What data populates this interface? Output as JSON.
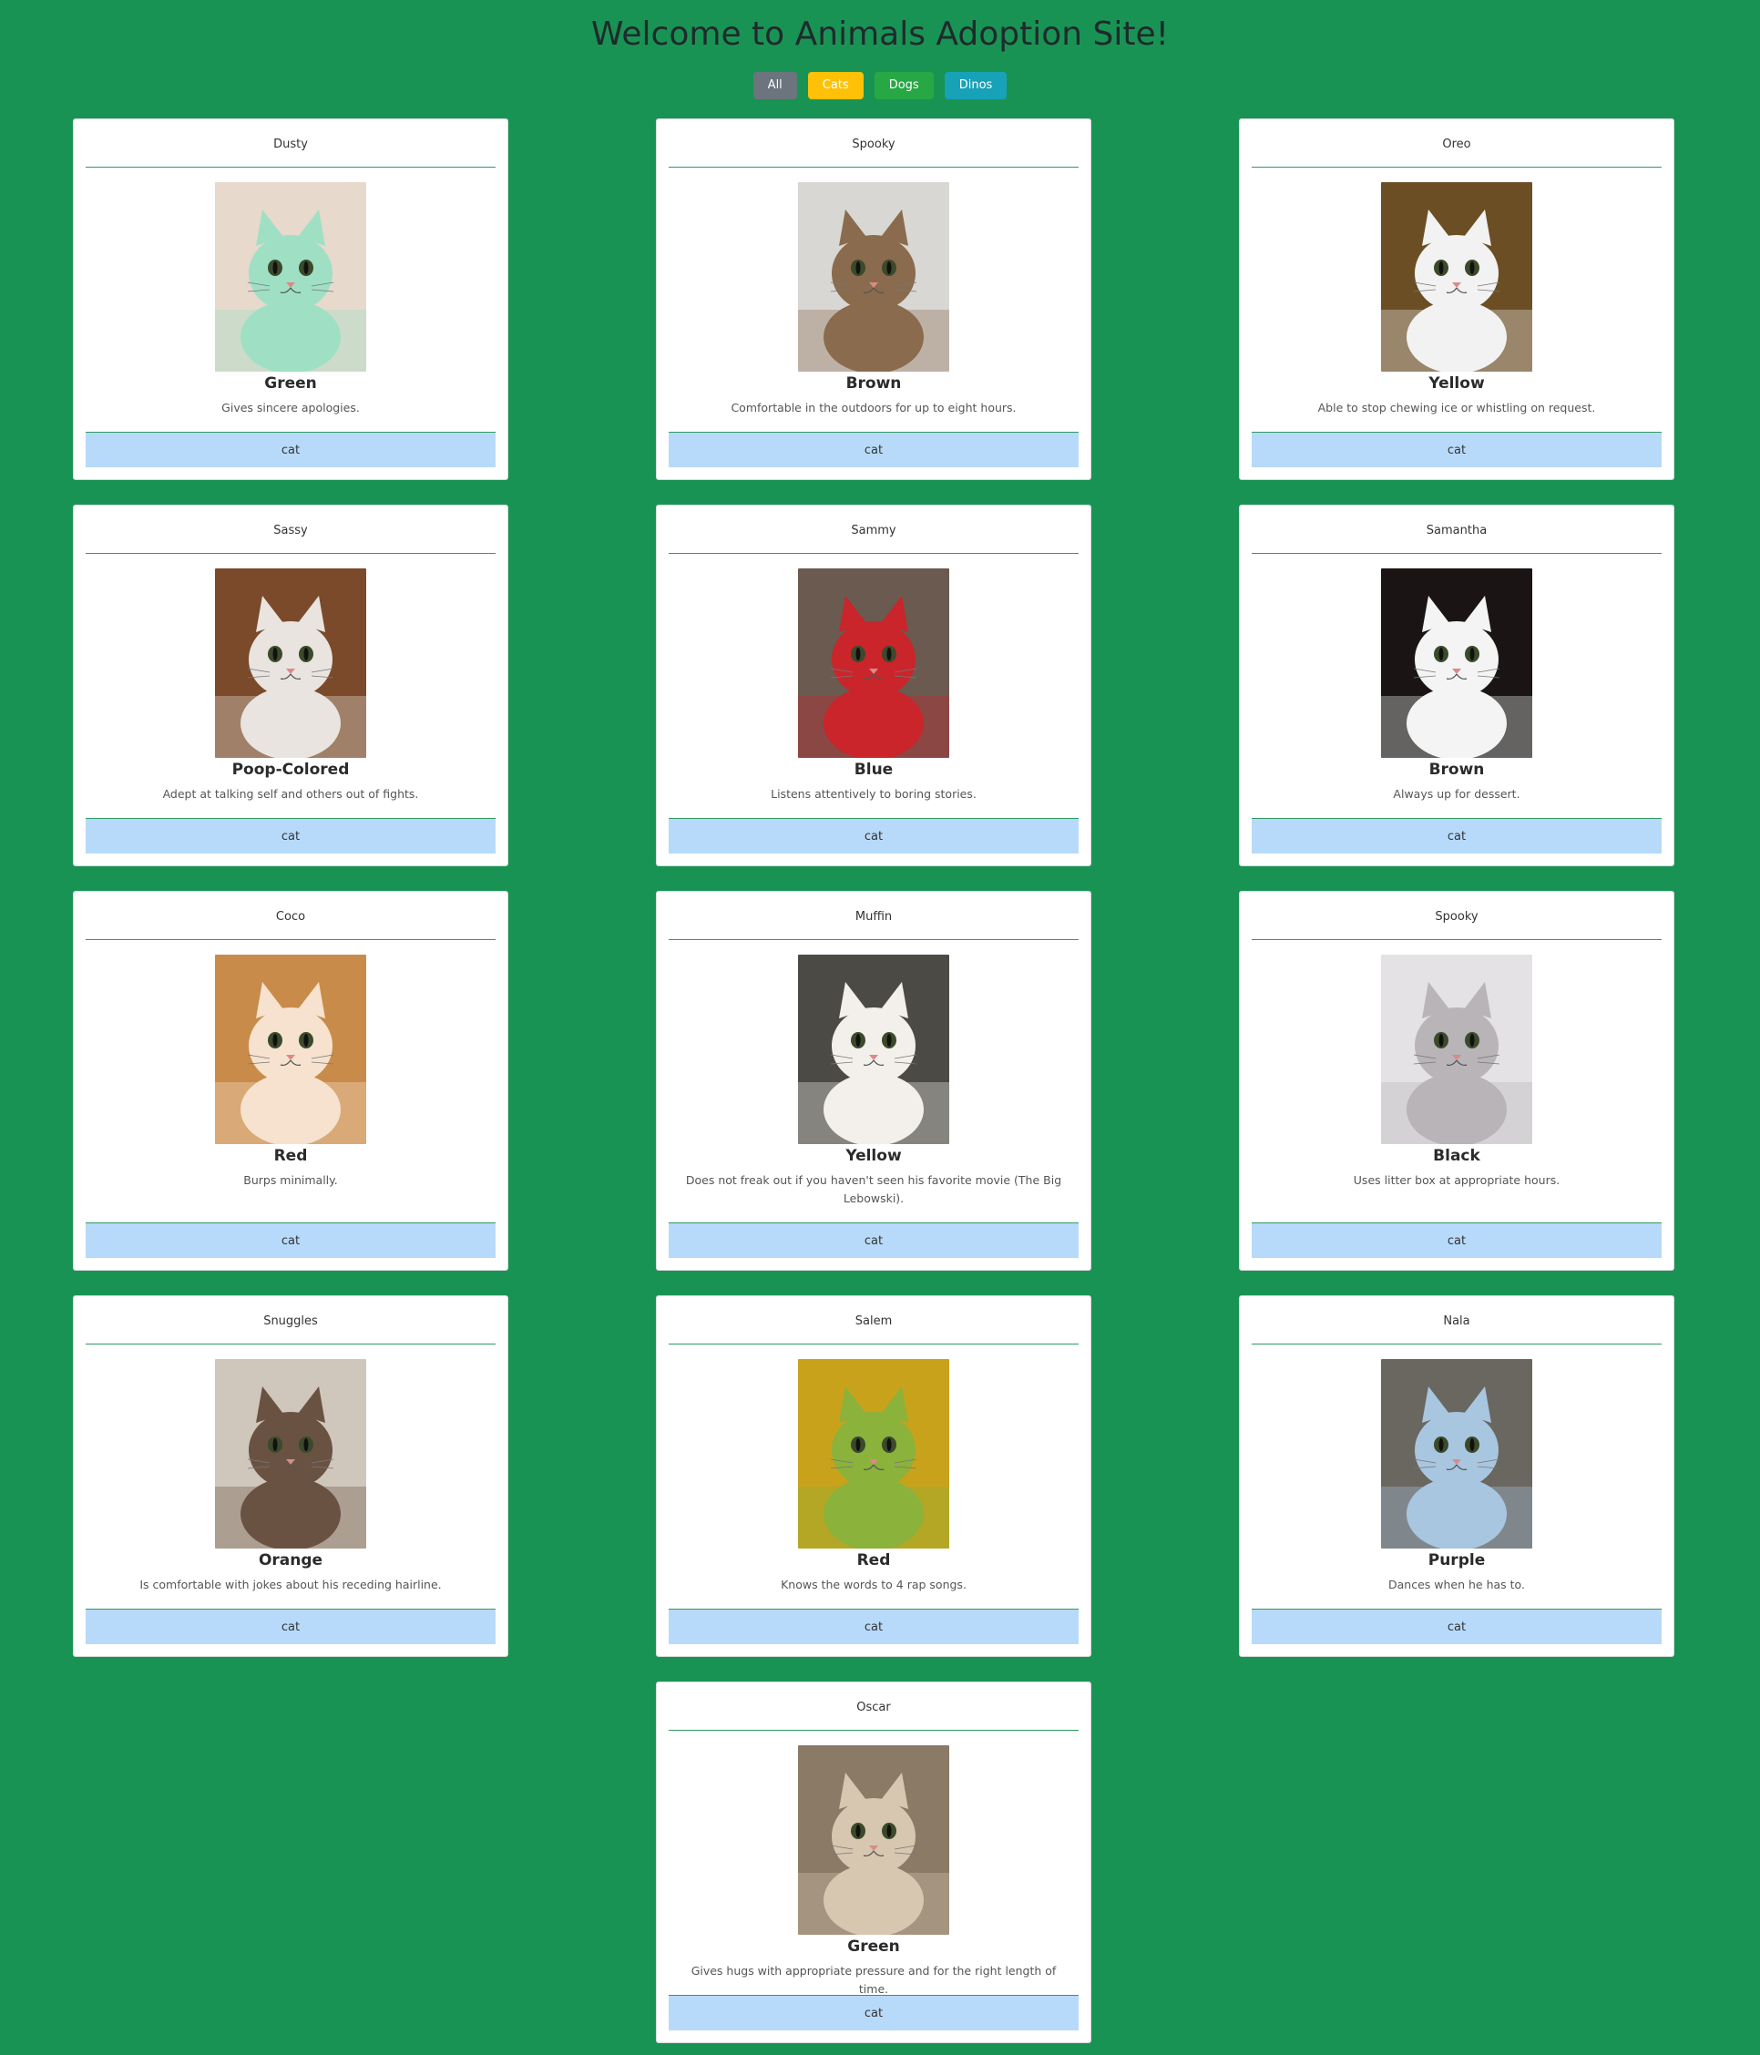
{
  "page": {
    "title": "Welcome to Animals Adoption Site!"
  },
  "filters": [
    {
      "label": "All",
      "color": "#6c757d"
    },
    {
      "label": "Cats",
      "color": "#ffc107"
    },
    {
      "label": "Dogs",
      "color": "#28a745"
    },
    {
      "label": "Dinos",
      "color": "#17a2b8"
    }
  ],
  "cards": [
    {
      "name": "Dusty",
      "color": "Green",
      "description": "Gives sincere apologies.",
      "type": "cat",
      "photo_tone": "#e7d9cc",
      "photo_accent": "#9fe0c5"
    },
    {
      "name": "Spooky",
      "color": "Brown",
      "description": "Comfortable in the outdoors for up to eight hours.",
      "type": "cat",
      "photo_tone": "#d9d7d4",
      "photo_accent": "#8a6b4d"
    },
    {
      "name": "Oreo",
      "color": "Yellow",
      "description": "Able to stop chewing ice or whistling on request.",
      "type": "cat",
      "photo_tone": "#6b4e24",
      "photo_accent": "#f2f2f2"
    },
    {
      "name": "Sassy",
      "color": "Poop-Colored",
      "description": "Adept at talking self and others out of fights.",
      "type": "cat",
      "photo_tone": "#7a4a2a",
      "photo_accent": "#e9e4df"
    },
    {
      "name": "Sammy",
      "color": "Blue",
      "description": "Listens attentively to boring stories.",
      "type": "cat",
      "photo_tone": "#6a5a50",
      "photo_accent": "#c9252b"
    },
    {
      "name": "Samantha",
      "color": "Brown",
      "description": "Always up for dessert.",
      "type": "cat",
      "photo_tone": "#1a1514",
      "photo_accent": "#f4f4f4"
    },
    {
      "name": "Coco",
      "color": "Red",
      "description": "Burps minimally.",
      "type": "cat",
      "photo_tone": "#c98b4a",
      "photo_accent": "#f6e2cf"
    },
    {
      "name": "Muffin",
      "color": "Yellow",
      "description": "Does not freak out if you haven't seen his favorite movie (The Big Lebowski).",
      "type": "cat",
      "photo_tone": "#4c4a44",
      "photo_accent": "#f3f0ec"
    },
    {
      "name": "Spooky",
      "color": "Black",
      "description": "Uses litter box at appropriate hours.",
      "type": "cat",
      "photo_tone": "#e4e2e4",
      "photo_accent": "#b8b4b8"
    },
    {
      "name": "Snuggles",
      "color": "Orange",
      "description": "Is comfortable with jokes about his receding hairline.",
      "type": "cat",
      "photo_tone": "#cfc6bc",
      "photo_accent": "#6a5242"
    },
    {
      "name": "Salem",
      "color": "Red",
      "description": "Knows the words to 4 rap songs.",
      "type": "cat",
      "photo_tone": "#c9a21c",
      "photo_accent": "#8bb23a"
    },
    {
      "name": "Nala",
      "color": "Purple",
      "description": "Dances when he has to.",
      "type": "cat",
      "photo_tone": "#6a6660",
      "photo_accent": "#a9c6e0"
    },
    {
      "name": "Oscar",
      "color": "Green",
      "description": "Gives hugs with appropriate pressure and for the right length of time.",
      "type": "cat",
      "photo_tone": "#8a7a66",
      "photo_accent": "#d7c7b0"
    }
  ]
}
